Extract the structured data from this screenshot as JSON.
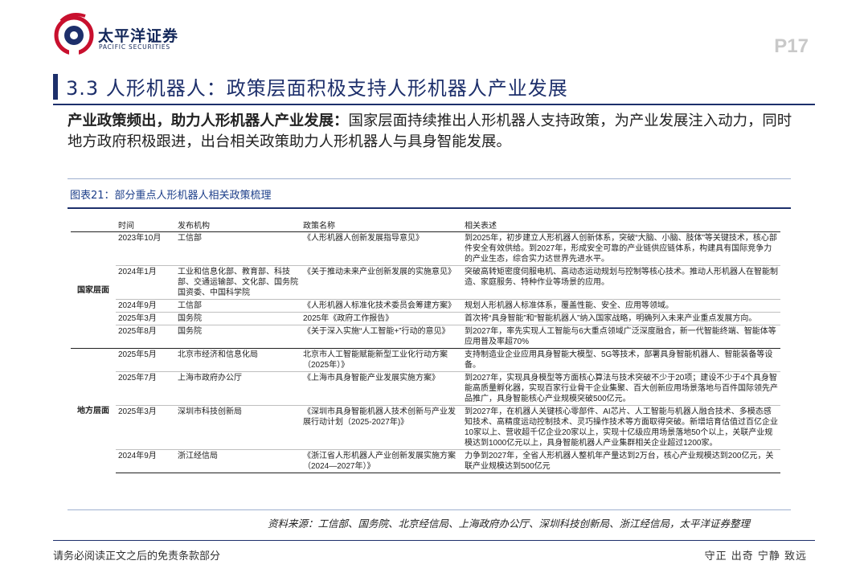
{
  "header": {
    "brand_cn": "太平洋证券",
    "brand_en": "PACIFIC SECURITIES",
    "page": "P17"
  },
  "section": {
    "title": "3.3 人形机器人：政策层面积极支持人形机器人产业发展"
  },
  "lead": {
    "bold": "产业政策频出，助力人形机器人产业发展：",
    "text": "国家层面持续推出人形机器人支持政策，为产业发展注入动力，同时地方政府积极跟进，出台相关政策助力人形机器人与具身智能发展。"
  },
  "figure": {
    "caption": "图表21：部分重点人形机器人相关政策梳理",
    "columns": [
      "时间",
      "发布机构",
      "政策名称",
      "相关表述"
    ],
    "groups": [
      "国家层面",
      "地方层面"
    ],
    "rows": [
      [
        "2023年10月",
        "工信部",
        "《人形机器人创新发展指导意见》",
        "到2025年，初步建立人形机器人创新体系，突破“大脑、小脑、肢体”等关键技术，核心部件安全有效供给。到2027年，形成安全可靠的产业链供应链体系，构建具有国际竞争力的产业生态，综合实力达世界先进水平。"
      ],
      [
        "2024年1月",
        "工业和信息化部、教育部、科技部、交通运输部、文化部、国务院国资委、中国科学院",
        "《关于推动未来产业创新发展的实施意见》",
        "突破高转矩密度伺服电机、高动态运动规划与控制等核心技术。推动人形机器人在智能制造、家庭服务、特种作业等场景的应用。"
      ],
      [
        "2024年9月",
        "工信部",
        "《人形机器人标准化技术委员会筹建方案》",
        "规划人形机器人标准体系，覆盖性能、安全、应用等领域。"
      ],
      [
        "2025年3月",
        "国务院",
        "2025年《政府工作报告》",
        "首次将“具身智能”和“智能机器人”纳入国家战略，明确列入未来产业重点发展方向。"
      ],
      [
        "2025年8月",
        "国务院",
        "《关于深入实施“人工智能+”行动的意见》",
        "到2027年，率先实现人工智能与6大重点领域广泛深度融合，新一代智能终端、智能体等应用普及率超70%"
      ],
      [
        "2025年5月",
        "北京市经济和信息化局",
        "北京市人工智能赋能新型工业化行动方案（2025年）》",
        "支持制造业企业应用具身智能大模型、5G等技术，部署具身智能机器人、智能装备等设备。"
      ],
      [
        "2025年7月",
        "上海市政府办公厅",
        "《上海市具身智能产业发展实施方案》",
        "到2027年，实现具身模型等方面核心算法与技术突破不少于20项；建设不少于4个具身智能高质量孵化器，实现百家行业骨干企业集聚、百大创新应用场景落地与百件国际领先产品推广，具身智能核心产业规模突破500亿元。"
      ],
      [
        "2025年3月",
        "深圳市科技创新局",
        "《深圳市具身智能机器人技术创新与产业发展行动计划（2025-2027年)》",
        "到2027年，在机器人关键核心零部件、AI芯片、人工智能与机器人融合技术、多模态感知技术、高精度运动控制技术、灵巧操作技术等方面取得突破。新增培育估值过百亿企业10家以上、营收超千亿企业20家以上，实现十亿级应用场景落地50个以上，关联产业规模达到1000亿元以上，具身智能机器人产业集群相关企业超过1200家。"
      ],
      [
        "2024年9月",
        "浙江经信局",
        "《浙江省人形机器人产业创新发展实施方案（2024—2027年）》",
        "力争到2027年，全省人形机器人整机年产量达到2万台，核心产业规模达到200亿元，关联产业规模达到500亿元"
      ]
    ],
    "source": "资料来源：工信部、国务院、北京经信局、上海政府办公厅、深圳科技创新局、浙江经信局，太平洋证券整理"
  },
  "footer": {
    "left": "请务必阅读正文之后的免责条款部分",
    "right": "守正 出奇 宁静 致远"
  },
  "colors": {
    "brand_navy": "#1d2f6b",
    "brand_red": "#c8102e",
    "caption_blue": "#1d3f8a"
  }
}
